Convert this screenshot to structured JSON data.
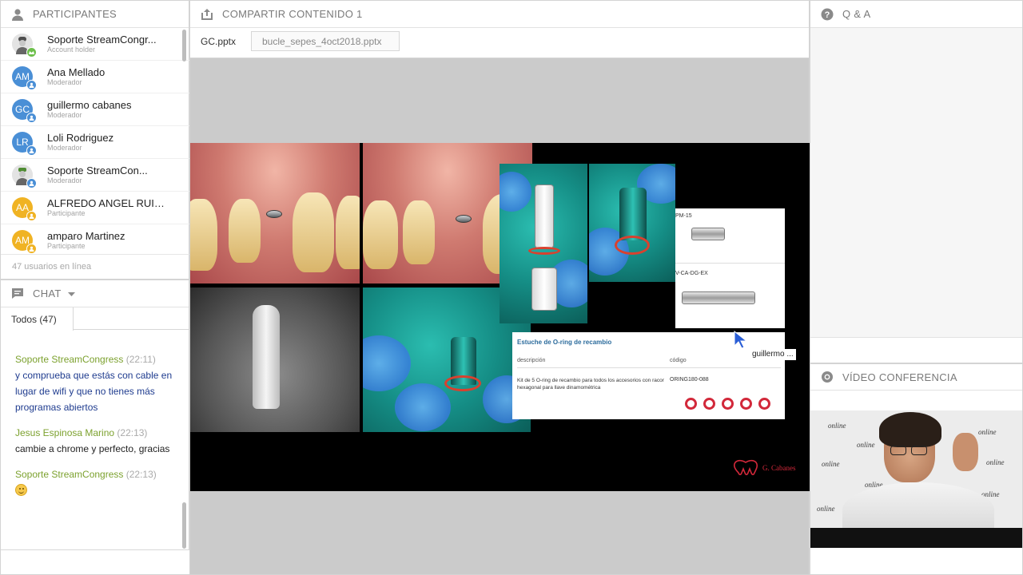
{
  "participants": {
    "title": "PARTICIPANTES",
    "items": [
      {
        "name": "Soporte StreamCongr...",
        "role": "Account holder",
        "initials": "",
        "color": "#9e9e9e",
        "badge": "#6dbf4b"
      },
      {
        "name": "Ana Mellado",
        "role": "Moderador",
        "initials": "AM",
        "color": "#4a8fd6",
        "badge": "#4a8fd6"
      },
      {
        "name": "guillermo cabanes",
        "role": "Moderador",
        "initials": "GC",
        "color": "#4a8fd6",
        "badge": "#4a8fd6"
      },
      {
        "name": "Loli Rodriguez",
        "role": "Moderador",
        "initials": "LR",
        "color": "#4a8fd6",
        "badge": "#4a8fd6"
      },
      {
        "name": "Soporte   StreamCon...",
        "role": "Moderador",
        "initials": "",
        "color": "#9e9e9e",
        "badge": "#4a8fd6"
      },
      {
        "name": "ALFREDO ANGEL RUIZ...",
        "role": "Participante",
        "initials": "AA",
        "color": "#f0b323",
        "badge": "#f0b323"
      },
      {
        "name": "amparo Martinez",
        "role": "Participante",
        "initials": "AM",
        "color": "#f0b323",
        "badge": "#f0b323"
      }
    ],
    "online_count": "47 usuarios en línea"
  },
  "chat": {
    "title": "CHAT",
    "tab_label": "Todos (47)",
    "messages": [
      {
        "author": "Soporte StreamCongress",
        "time": "(22:11)",
        "text": "y comprueba que estás con cable en lugar de wifi y que no tienes más programas abiertos"
      },
      {
        "author": "Jesus Espinosa Marino",
        "time": "(22:13)",
        "text": "cambie a chrome y perfecto, gracias"
      },
      {
        "author": "Soporte StreamCongress",
        "time": "(22:13)",
        "text": ""
      }
    ]
  },
  "share": {
    "title": "COMPARTIR CONTENIDO 1",
    "tabs": [
      "GC.pptx",
      "bucle_sepes_4oct2018.pptx"
    ],
    "slide": {
      "catalog_items": [
        "PM-15",
        "V-CA-DG-EX"
      ],
      "table_title": "Estuche de O-ring de recambio",
      "col_description": "descripción",
      "col_code": "código",
      "description": "Kit de 5 O-ring de recambio para todos los accesorios con racor hexagonal para llave dinamométrica",
      "code": "ORING180-088",
      "brand": "G. Cabanes"
    },
    "cursor_label": "guillermo ..."
  },
  "qa": {
    "title": "Q & A"
  },
  "video": {
    "title": "VÍDEO CONFERENCIA",
    "wall_logo": "online"
  },
  "colors": {
    "accent_green": "#7ca12e",
    "chat_blue": "#1f3c8f",
    "moderator_blue": "#4a8fd6",
    "participant_yellow": "#f0b323",
    "brand_red": "#d2283a"
  }
}
